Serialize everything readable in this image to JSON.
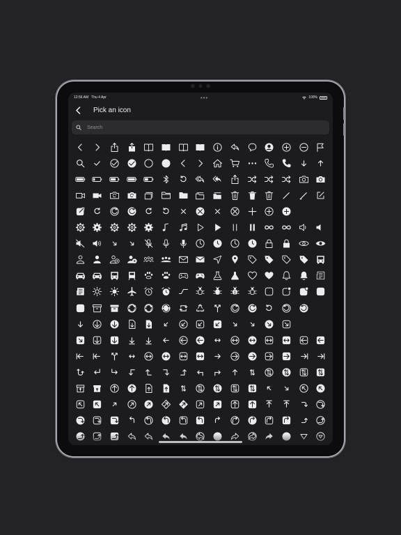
{
  "status": {
    "time": "12:56 AM",
    "date": "Thu 4 Apr",
    "battery": "100%"
  },
  "nav": {
    "title": "Pick an icon",
    "back_icon": "chevron-left-icon"
  },
  "search": {
    "placeholder": "Search",
    "icon": "magnifying-glass-icon"
  },
  "icons": [
    [
      "chevron-left",
      "chevron-right",
      "share",
      "share-filled",
      "book",
      "book-filled",
      "bookmark",
      "bookmark-filled",
      "info-circle",
      "reply-bubble",
      "chat-bubble",
      "person-circle",
      "plus-circle",
      "minus-circle",
      "flag"
    ],
    [
      "magnifying-glass",
      "checkmark",
      "checkmark-circle",
      "checkmark-circle-filled",
      "circle",
      "circle-filled",
      "chevron-left",
      "chevron-right",
      "house",
      "cart",
      "ellipsis",
      "phone",
      "phone-filled",
      "arrow-down",
      "arrow-up"
    ],
    [
      "battery-100",
      "battery-25",
      "battery-75",
      "battery-100-filled",
      "battery-50",
      "bluetooth",
      "arrow-counterclockwise",
      "reply-all",
      "reply-all-filled",
      "share",
      "shuffle",
      "shuffle",
      "shuffle",
      "camera",
      "camera-filled"
    ],
    [
      "video",
      "video-filled",
      "camera-rotate",
      "camera-rotate-filled",
      "square-stack",
      "folder",
      "folder-filled",
      "folder-stack",
      "folder-stack-filled",
      "trash",
      "trash-filled",
      "trash",
      "pencil",
      "pencil-line",
      "pencil-square"
    ],
    [
      "pencil-square-filled",
      "arrow-clockwise",
      "arrow-clockwise-circle",
      "arrow-clockwise-circle-filled",
      "arrow-clockwise",
      "arrow-counterclockwise",
      "xmark",
      "xmark-circle-filled",
      "xmark",
      "xmark-circle",
      "plus",
      "plus-circle",
      "plus-circle-filled"
    ],
    [
      "gear",
      "gear-filled",
      "gearshape",
      "gearshape-2",
      "gearshape-2-filled",
      "music-note",
      "music-note-double",
      "play",
      "play-filled",
      "pause",
      "pause-filled",
      "infinity",
      "infinity",
      "speaker",
      "speaker-filled"
    ],
    [
      "speaker-slash",
      "speaker-wave",
      "arrow-up-left-down-right",
      "arrow-down-right-up-left",
      "mic-slash",
      "mic",
      "mic-filled",
      "clock",
      "clock-filled",
      "clock",
      "clock-filled",
      "lock",
      "lock-filled",
      "eye",
      "eye-filled"
    ],
    [
      "person",
      "person-filled",
      "person-badge-plus",
      "person-badge-plus-filled",
      "person-3",
      "person-3-filled",
      "envelope",
      "envelope-filled",
      "location-arrow",
      "pin-filled",
      "tag",
      "tag-filled",
      "tag",
      "tag-filled",
      "bus"
    ],
    [
      "car",
      "car-filled",
      "bus-filled",
      "tram",
      "paw",
      "paw-filled",
      "gamecontroller",
      "gamecontroller-filled",
      "flask",
      "flask-filled",
      "heart",
      "heart-filled",
      "bell",
      "bell-filled",
      "newspaper"
    ],
    [
      "newspaper-filled",
      "sun",
      "sun-filled",
      "airplane",
      "alarm",
      "alarm-filled",
      "waveform",
      "ant",
      "ant-filled",
      "ladybug",
      "antenna",
      "app",
      "app-badge",
      "app-badge-filled",
      "app-filled"
    ],
    [
      "app-filled",
      "archive",
      "archive-filled",
      "arrow-2-circlepath",
      "arrow-2-circlepath-circle",
      "arrow-2-circlepath-circle-filled",
      "arrow-2-squarepath",
      "recycle",
      "arrow-merge",
      "arrow-clockwise-circle",
      "arrow-clockwise-circle-filled",
      "arrow-counterclockwise",
      "arrow-counterclockwise-circle",
      "arrow-counterclockwise-circle-filled"
    ],
    [
      "arrow-down",
      "arrow-down-circle",
      "arrow-down-circle-filled",
      "arrow-down-doc",
      "arrow-down-doc-filled",
      "arrow-down-left",
      "arrow-down-left-circle",
      "arrow-down-left-square",
      "arrow-down-left-square-filled",
      "arrow-down-right",
      "arrow-down-right-arrow-up-left",
      "arrow-down-right-circle-filled",
      "arrow-down-right-square"
    ],
    [
      "arrow-down-right-square-filled",
      "arrow-down-square",
      "arrow-down-square-filled",
      "arrow-down-to-line",
      "arrow-down-to-line-alt",
      "arrow-left",
      "arrow-left-circle",
      "arrow-left-circle-filled",
      "arrow-left-right",
      "arrow-left-right-circle",
      "arrow-left-right-circle-filled",
      "arrow-left-right-square",
      "arrow-left-right-square-filled",
      "arrow-left-square",
      "arrow-left-square-filled"
    ],
    [
      "arrow-left-to-line",
      "arrow-left-to-line-alt",
      "arrow-merge",
      "arrow-right-arrow-left",
      "arrow-right-arrow-left-circle",
      "arrow-right-arrow-left-circle-filled",
      "arrow-right-arrow-left-square",
      "arrow-right-arrow-left-square-filled",
      "arrow-right",
      "arrow-right-circle",
      "arrow-right-circle-filled",
      "arrow-right-square",
      "arrow-right-square-filled",
      "arrow-right-to-line",
      "arrow-right-to-line-alt"
    ],
    [
      "arrow-swap",
      "arrow-turn-down-left",
      "arrow-turn-down-right",
      "arrow-turn-left-down",
      "arrow-turn-left-up",
      "arrow-turn-right-down",
      "arrow-turn-right-up",
      "arrow-turn-up-left",
      "arrow-turn-up-right",
      "arrow-up",
      "arrow-up-arrow-down",
      "arrow-up-arrow-down-circle",
      "arrow-up-arrow-down-circle-filled",
      "arrow-up-arrow-down-square",
      "arrow-up-arrow-down-square-filled"
    ],
    [
      "arrow-up-bin",
      "arrow-up-bin-filled",
      "arrow-up-circle",
      "arrow-up-circle-filled",
      "arrow-up-doc",
      "arrow-up-doc-filled",
      "arrow-up-down",
      "arrow-up-down-circle",
      "arrow-up-down-circle-filled",
      "arrow-up-down-square",
      "arrow-up-down-square-filled",
      "arrow-up-left",
      "arrow-up-left-arrow-down-right",
      "arrow-up-left-circle",
      "arrow-up-left-circle-filled"
    ],
    [
      "arrow-up-left-square",
      "arrow-up-left-square-filled",
      "arrow-up-right",
      "arrow-up-right-circle",
      "arrow-up-right-circle-filled",
      "arrow-up-right-diamond",
      "arrow-up-right-diamond-filled",
      "arrow-up-right-square",
      "arrow-up-right-square-filled",
      "arrow-up-square",
      "arrow-up-square-filled",
      "arrow-up-to-line",
      "arrow-up-to-line-alt",
      "arrow-uturn-down",
      "arrow-uturn-down-circle"
    ],
    [
      "arrow-uturn-down-circle-filled",
      "arrow-uturn-down-square",
      "arrow-uturn-down-square-filled",
      "arrow-uturn-left",
      "arrow-uturn-left-circle",
      "arrow-uturn-left-circle-filled",
      "arrow-uturn-left-square",
      "arrow-uturn-left-square-filled",
      "arrow-uturn-right",
      "arrow-uturn-right-circle",
      "arrow-uturn-right-circle-filled",
      "arrow-uturn-right-square",
      "arrow-uturn-right-square-filled",
      "arrow-uturn-up",
      "arrow-uturn-up-circle"
    ],
    [
      "arrow-uturn-up-circle-filled",
      "arrow-uturn-up-square",
      "arrow-uturn-up-square-filled",
      "arrowshape-turn-up-left",
      "arrowshape-turn-up-left-2",
      "arrowshape-turn-up-left-2-filled",
      "arrowshape-turn-up-left-filled",
      "arrowshape-turn-up-left-circle",
      "arrowshape-turn-up-left-circle-filled",
      "arrowshape-turn-up-right",
      "arrowshape-turn-up-right-circle",
      "arrowshape-turn-up-right-filled",
      "arrowshape-turn-up-right-circle-filled",
      "arrowtriangle-down",
      "arrowtriangle-down-circle"
    ]
  ]
}
